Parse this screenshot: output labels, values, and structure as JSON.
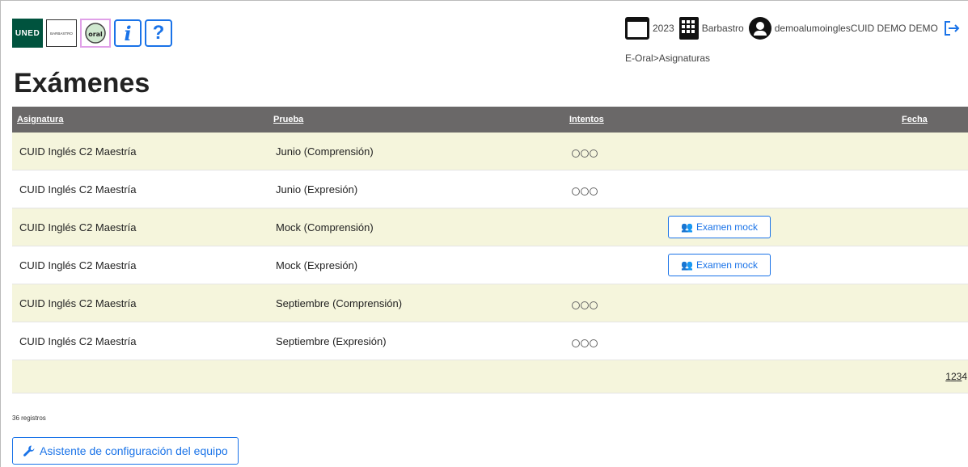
{
  "header": {
    "logos": {
      "uned": "UNED",
      "barbastro": "BARBASTRO",
      "oral": "oral"
    },
    "info_label": "i",
    "help_label": "?",
    "year": "2023",
    "center": "Barbastro",
    "user": "demoalumoinglesCUID DEMO DEMO"
  },
  "breadcrumb": {
    "root": "E-Oral",
    "sep": ">",
    "current": "Asignaturas"
  },
  "page_title": "Exámenes",
  "table": {
    "headers": {
      "asignatura": "Asignatura",
      "prueba": "Prueba",
      "intentos": "Intentos",
      "fecha": "Fecha"
    },
    "rows": [
      {
        "asignatura": "CUID Inglés C2 Maestría",
        "prueba": "Junio (Comprensión)",
        "dots": 3
      },
      {
        "asignatura": "CUID Inglés C2 Maestría",
        "prueba": "Junio (Expresión)",
        "dots": 3
      },
      {
        "asignatura": "CUID Inglés C2 Maestría",
        "prueba": "Mock (Comprensión)",
        "button": "Examen mock"
      },
      {
        "asignatura": "CUID Inglés C2 Maestría",
        "prueba": "Mock (Expresión)",
        "button": "Examen mock"
      },
      {
        "asignatura": "CUID Inglés C2 Maestría",
        "prueba": "Septiembre (Comprensión)",
        "dots": 3
      },
      {
        "asignatura": "CUID Inglés C2 Maestría",
        "prueba": "Septiembre (Expresión)",
        "dots": 3
      }
    ],
    "pages": [
      "1",
      "2",
      "3",
      "4"
    ]
  },
  "records": "36 registros",
  "setup_button": "Asistente de configuración del equipo",
  "colors": {
    "accent": "#1a73e8",
    "header_bg": "#6a6868",
    "odd_row": "#f5f5dc"
  }
}
